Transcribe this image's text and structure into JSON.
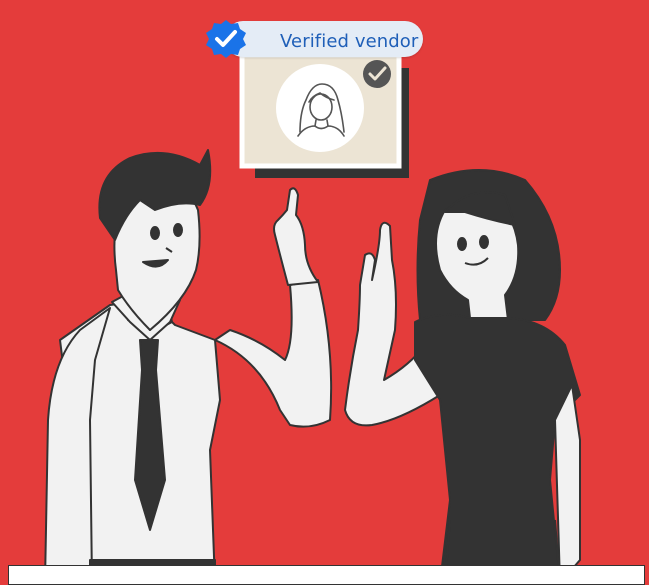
{
  "badge": {
    "label": "Verified vendor",
    "icon": "verified-check-icon",
    "pill_color": "#e4ecf6",
    "icon_color": "#1a73e8"
  },
  "profile_card": {
    "avatar_icon": "woman-avatar-icon",
    "check_icon": "verified-check-icon"
  },
  "colors": {
    "background": "#e43c3b",
    "dark": "#333333",
    "light": "#f2f2f2"
  }
}
